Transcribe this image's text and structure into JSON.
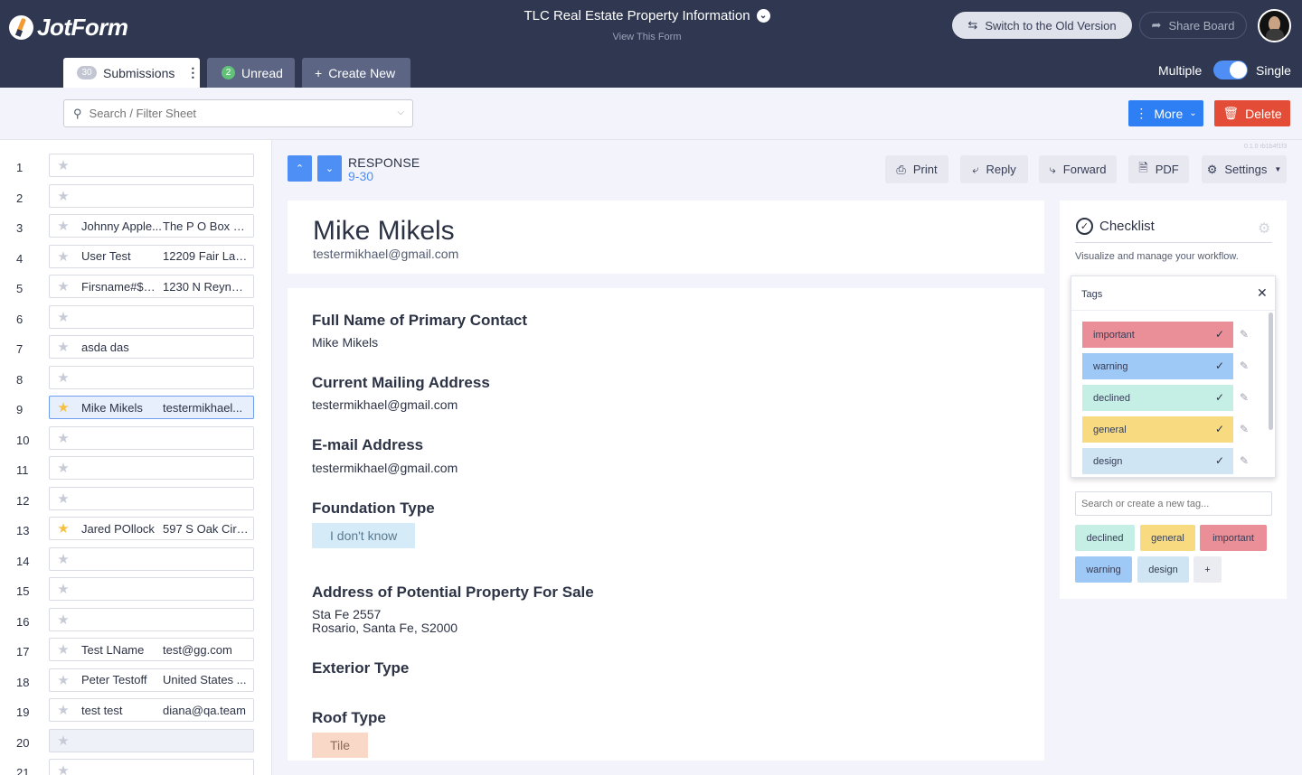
{
  "header": {
    "logo_text": "JotForm",
    "form_title": "TLC Real Estate Property Information",
    "view_form": "View This Form",
    "switch_label": "Switch to the Old Version",
    "share_label": "Share Board"
  },
  "tabs": {
    "submissions_count": "30",
    "submissions_label": "Submissions",
    "unread_count": "2",
    "unread_label": "Unread",
    "create_label": "Create New",
    "multiple_label": "Multiple",
    "single_label": "Single",
    "single_selected": true
  },
  "toolbar": {
    "search_placeholder": "Search / Filter Sheet",
    "more_label": "More",
    "delete_label": "Delete"
  },
  "rows": [
    {
      "n": "1",
      "a": "",
      "b": "",
      "starred": false
    },
    {
      "n": "2",
      "a": "",
      "b": "",
      "starred": false
    },
    {
      "n": "3",
      "a": "Johnny Apple...",
      "b": "The P O Box 1...",
      "starred": false
    },
    {
      "n": "4",
      "a": "User Test",
      "b": "12209 Fair Lak...",
      "starred": false
    },
    {
      "n": "5",
      "a": "Firsname#$%...",
      "b": "1230 N Reynol...",
      "starred": false
    },
    {
      "n": "6",
      "a": "",
      "b": "",
      "starred": false
    },
    {
      "n": "7",
      "a": "asda das",
      "b": "",
      "starred": false
    },
    {
      "n": "8",
      "a": "",
      "b": "",
      "starred": false
    },
    {
      "n": "9",
      "a": "Mike Mikels",
      "b": "testermikhael...",
      "starred": true,
      "selected": true
    },
    {
      "n": "10",
      "a": "",
      "b": "",
      "starred": false
    },
    {
      "n": "11",
      "a": "",
      "b": "",
      "starred": false
    },
    {
      "n": "12",
      "a": "",
      "b": "",
      "starred": false
    },
    {
      "n": "13",
      "a": "Jared POllock",
      "b": "597 S Oak Cir ...",
      "starred": true
    },
    {
      "n": "14",
      "a": "",
      "b": "",
      "starred": false
    },
    {
      "n": "15",
      "a": "",
      "b": "",
      "starred": false
    },
    {
      "n": "16",
      "a": "",
      "b": "",
      "starred": false
    },
    {
      "n": "17",
      "a": "Test LName",
      "b": "test@gg.com",
      "starred": false
    },
    {
      "n": "18",
      "a": "Peter Testoff",
      "b": "United States ...",
      "starred": false
    },
    {
      "n": "19",
      "a": "test test",
      "b": "diana@qa.team",
      "starred": false
    },
    {
      "n": "20",
      "a": "",
      "b": "",
      "starred": false,
      "shaded": true
    },
    {
      "n": "21",
      "a": "",
      "b": "",
      "starred": false
    }
  ],
  "response": {
    "label": "RESPONSE",
    "position": "9-30",
    "version": "0.1.0 rb1b4f1f3",
    "print_label": "Print",
    "reply_label": "Reply",
    "forward_label": "Forward",
    "pdf_label": "PDF",
    "settings_label": "Settings",
    "name": "Mike Mikels",
    "email": "testermikhael@gmail.com",
    "fields": {
      "q1": "Full Name of Primary Contact",
      "a1": "Mike Mikels",
      "q2": "Current Mailing Address",
      "a2": "testermikhael@gmail.com",
      "q3": "E-mail Address",
      "a3": "testermikhael@gmail.com",
      "q4": "Foundation Type",
      "a4": "I don't know",
      "q5": "Address of Potential Property For Sale",
      "a5_line1": "Sta Fe 2557",
      "a5_line2": "Rosario, Santa Fe, S2000",
      "q6": "Exterior Type",
      "q7": "Roof Type",
      "a7": "Tile"
    }
  },
  "checklist": {
    "title": "Checklist",
    "description": "Visualize and manage your workflow.",
    "popup_title": "Tags",
    "tags": [
      {
        "label": "important",
        "color": "#ea8f98"
      },
      {
        "label": "warning",
        "color": "#9ec8f6"
      },
      {
        "label": "declined",
        "color": "#c5efe5"
      },
      {
        "label": "general",
        "color": "#f8db80"
      },
      {
        "label": "design",
        "color": "#cfe5f3"
      }
    ],
    "search_placeholder": "Search or create a new tag...",
    "pills": [
      {
        "label": "declined",
        "color": "#c5efe5"
      },
      {
        "label": "general",
        "color": "#f8db80"
      },
      {
        "label": "important",
        "color": "#ea8f98"
      },
      {
        "label": "warning",
        "color": "#9ec8f6"
      },
      {
        "label": "design",
        "color": "#cfe5f3"
      },
      {
        "label": "+",
        "color": "#ebecf1"
      }
    ]
  },
  "colors": {
    "header_bg": "#2f3850",
    "accent_blue": "#2e7ff4",
    "delete_red": "#e34c36",
    "star_gold": "#f6c143",
    "foundation_chip": "#d5ebf8",
    "roof_chip": "#fad8c8"
  }
}
